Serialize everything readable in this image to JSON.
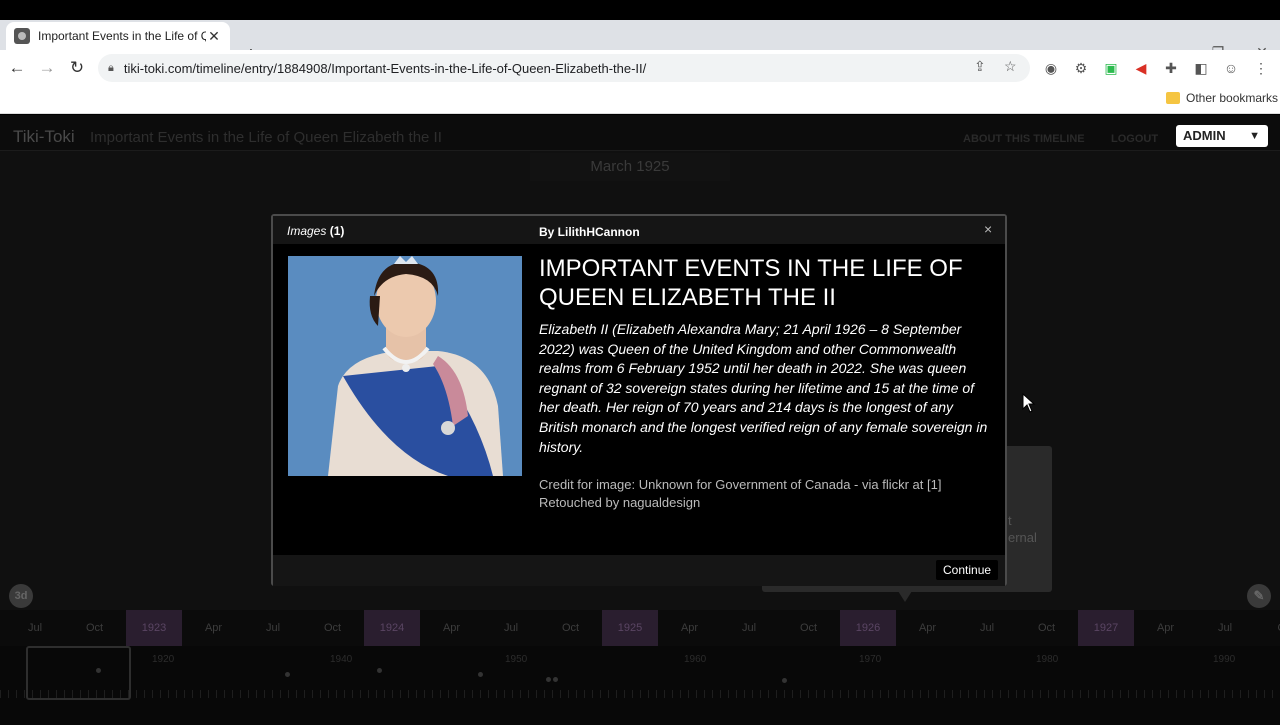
{
  "browser": {
    "tab_title": "Important Events in the Life of Q",
    "url": "tiki-toki.com/timeline/entry/1884908/Important-Events-in-the-Life-of-Queen-Elizabeth-the-II/",
    "bookmarks_label": "Other bookmarks"
  },
  "site": {
    "brand": "Tiki-Toki",
    "timeline_title": "Important Events in the Life of Queen Elizabeth the II",
    "nav": {
      "about": "ABOUT THIS TIMELINE",
      "logout": "LOGOUT",
      "admin": "ADMIN"
    },
    "current_month": "March 1925",
    "view_toggle": "3d",
    "bg_card_lines": [
      "t",
      "ernal"
    ]
  },
  "modal": {
    "images_label": "Images",
    "images_count": "(1)",
    "byline": "By LilithHCannon",
    "close": "×",
    "title": "IMPORTANT EVENTS IN THE LIFE OF QUEEN ELIZABETH THE II",
    "body": "Elizabeth II (Elizabeth Alexandra Mary; 21 April 1926 – 8 September 2022) was Queen of the United Kingdom and other Commonwealth realms from 6 February 1952 until her death in 2022. She was queen regnant of 32 sovereign states during her lifetime and 15 at the time of her death. Her reign of 70 years and 214 days is the longest of any British monarch and the longest verified reign of any female sovereign in history.",
    "credit_line1": "Credit for image: Unknown for Government of Canada - via flickr at [1]",
    "credit_line2": "Retouched by nagualdesign",
    "continue": "Continue"
  },
  "timeline": {
    "ticks": [
      "Jul",
      "Oct",
      "1923",
      "Apr",
      "Jul",
      "Oct",
      "1924",
      "Apr",
      "Jul",
      "Oct",
      "1925",
      "Apr",
      "Jul",
      "Oct",
      "1926",
      "Apr",
      "Jul",
      "Oct",
      "1927",
      "Apr",
      "Jul",
      "Oc"
    ],
    "minimap_years": [
      "1920",
      "1940",
      "1950",
      "1960",
      "1970",
      "1980",
      "1990"
    ]
  }
}
